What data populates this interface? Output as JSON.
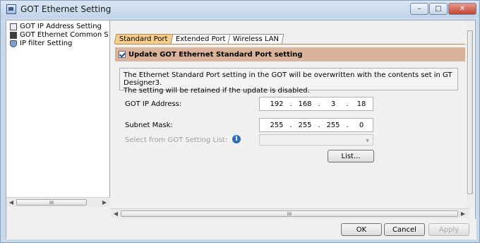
{
  "window": {
    "title": "GOT Ethernet Setting",
    "controls": {
      "minimize": "–",
      "maximize": "□",
      "close": "✕"
    }
  },
  "tree": {
    "items": [
      {
        "label": "GOT IP Address Setting",
        "icon": "page-icon"
      },
      {
        "label": "GOT Ethernet Common S",
        "icon": "network-icon"
      },
      {
        "label": "IP filter Setting",
        "icon": "shield-icon"
      }
    ],
    "scroll_thumb": "III"
  },
  "tabs": [
    {
      "label": "Standard Port",
      "active": true
    },
    {
      "label": "Extended Port",
      "active": false
    },
    {
      "label": "Wireless LAN",
      "active": false
    }
  ],
  "update_checkbox": {
    "label": "Update GOT Ethernet Standard Port setting",
    "checked": true
  },
  "info_text": {
    "line1": "The Ethernet Standard Port setting in the GOT will be overwritten with the contents set in GT Designer3.",
    "line2": "The setting will be retained if the update is disabled."
  },
  "ip_address": {
    "label": "GOT IP Address:",
    "octets": [
      "192",
      "168",
      "3",
      "18"
    ]
  },
  "subnet_mask": {
    "label": "Subnet Mask:",
    "octets": [
      "255",
      "255",
      "255",
      "0"
    ]
  },
  "setting_list": {
    "label": "Select from GOT Setting List:",
    "info_icon": "i",
    "value": ""
  },
  "list_button": "List...",
  "main_scroll_thumb": "III",
  "buttons": {
    "ok": "OK",
    "cancel": "Cancel",
    "apply": "Apply"
  }
}
